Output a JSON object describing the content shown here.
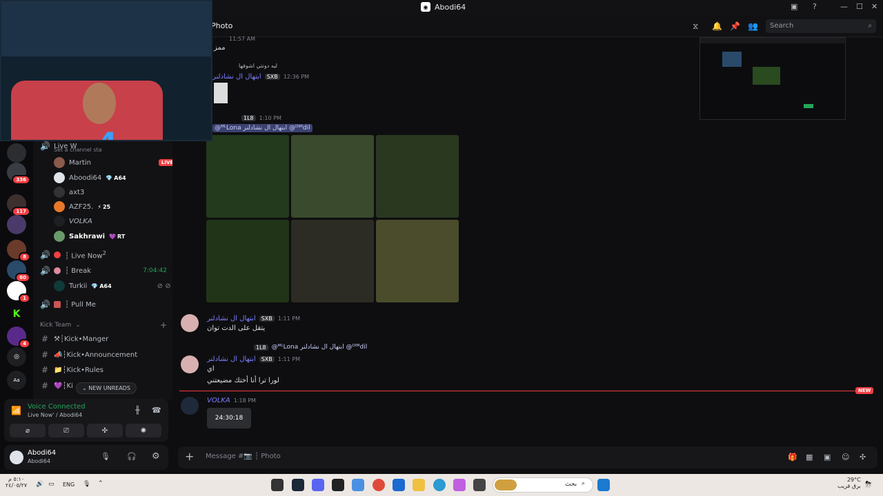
{
  "window": {
    "title": "Abodi64"
  },
  "header": {
    "channel": "Photo",
    "search_placeholder": "Search"
  },
  "guild_badges": [
    "336",
    "117",
    "8",
    "60",
    "1",
    "4"
  ],
  "channels": {
    "top_item": "Live W",
    "top_subtitle": "Set a channel sta",
    "users_a": [
      {
        "name": "Martin",
        "extra": "LIVE"
      },
      {
        "name": "Aboodi64",
        "extra": "A64"
      },
      {
        "name": "axt3",
        "extra": ""
      },
      {
        "name": "AZF25.",
        "extra": "25"
      },
      {
        "name": "VOLKA",
        "extra": ""
      },
      {
        "name": "Sakhrawi",
        "extra": "RT"
      }
    ],
    "voice_live": "Live Now",
    "voice_live_sup": "2",
    "voice_break": "Break",
    "break_time": "7:04:42",
    "break_user": "Turkii",
    "break_user_tag": "A64",
    "pull_me": "Pull Me",
    "category": "Kick Team",
    "text_channels": [
      "Kick•Manger",
      "Kick•Announcement",
      "Kick•Rules",
      "Ki"
    ],
    "new_unreads": "NEW UNREADS"
  },
  "voice": {
    "status": "Voice Connected",
    "sub": "Live Now' / Abodi64"
  },
  "user": {
    "name": "Abodi64",
    "sub": "Abodi64"
  },
  "messages": {
    "m0_time": "11:57 AM",
    "m0_text": "ممز",
    "m1_reply": "ليه دونتي اشوفها",
    "m1_name": "ابتهال ال نشادلنر",
    "m1_badge": "SXB",
    "m1_time": "12:36 PM",
    "m2_badge": "1L8",
    "m2_time": "1:10 PM",
    "m2_mention": "@ᴹᴸLona ابتهال ال نشادلنر @ᴰᴵᴹdil",
    "m3_name": "ابتهال ال نشادلنر",
    "m3_badge": "SXB",
    "m3_time": "1:11 PM",
    "m3_text": "يتقل على الدت توان",
    "m4_reply_badge": "1L8",
    "m4_reply": "@ᴹᴸLona ابتهال ال نشادلنر @ᴰᴵᴹdil",
    "m4_name": "ابتهال ال نشادلنر",
    "m4_badge": "SXB",
    "m4_time": "1:11 PM",
    "m4_text1": "اي",
    "m4_text2": "لورا ترا أنا أختك مضيعتني",
    "new_label": "NEW",
    "m5_name": "VOLKA",
    "m5_time": "1:18 PM",
    "m5_timer": "24:30:18"
  },
  "composer": {
    "placeholder": "Message #📷 ┆ Photo"
  },
  "taskbar": {
    "clock_time": "٥:١٠ م",
    "clock_date": "٢٤/٠٥/٢٧",
    "lang": "ENG",
    "search": "بحث",
    "weather_temp": "29°C",
    "weather_desc": "برق قريب"
  },
  "colors": {
    "accent": "#5865f2",
    "live": "#f23f43",
    "green": "#23a55a"
  }
}
